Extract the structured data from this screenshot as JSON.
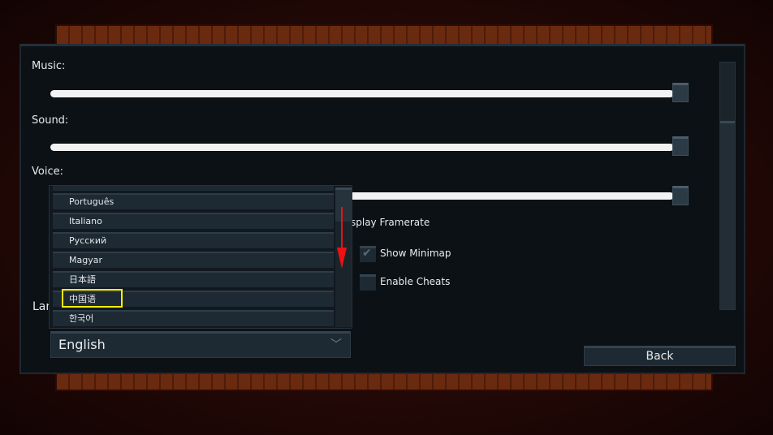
{
  "labels": {
    "music": "Music:",
    "sound": "Sound:",
    "voice": "Voice:",
    "language_partial": "Lan"
  },
  "volumes": {
    "music": 1.0,
    "sound": 1.0,
    "voice": 1.0
  },
  "language_options": [
    "Português",
    "Italiano",
    "Русский",
    "Magyar",
    "日本語",
    "中国语",
    "한국어"
  ],
  "language_selected": "English",
  "highlighted_option": "中国语",
  "checkboxes": {
    "display_framerate": {
      "label": "splay Framerate"
    },
    "show_minimap": {
      "label": "Show Minimap",
      "checked": true
    },
    "enable_cheats": {
      "label": "Enable Cheats",
      "checked": false
    }
  },
  "back_label": "Back",
  "icons": {
    "chevron": "chevron-down-icon",
    "check": "check-icon",
    "arrow": "arrow-down-icon"
  },
  "colors": {
    "highlight": "#ffee00",
    "arrow": "#ee1111"
  }
}
